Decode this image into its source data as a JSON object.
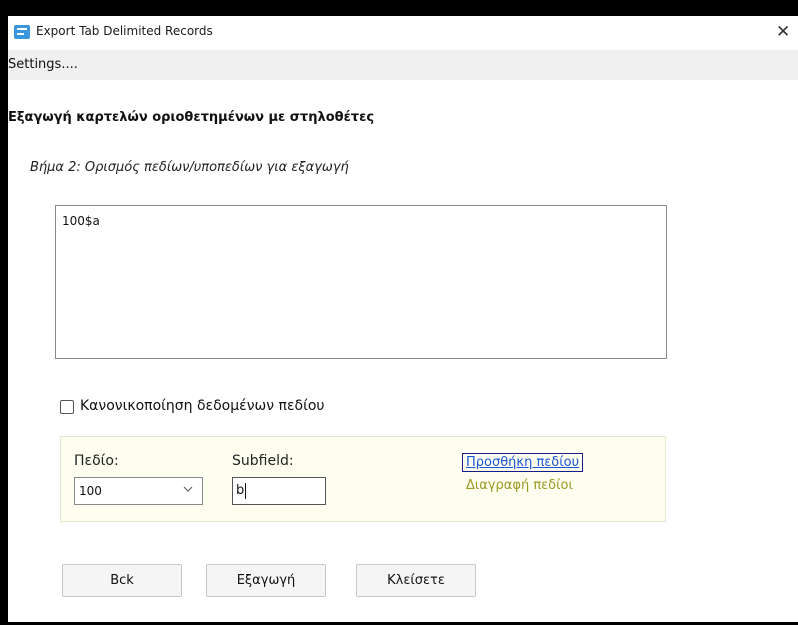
{
  "window": {
    "title": "Export Tab Delimited Records",
    "close_glyph": "✕",
    "app_icon": "table-export-icon"
  },
  "menubar": {
    "settings_label": "Settings...."
  },
  "page": {
    "heading": "Εξαγωγή καρτελών οριοθετημένων με στηλοθέτες",
    "step": "Βήμα 2: Ορισμός πεδίων/υποπεδίων για εξαγωγή"
  },
  "fields_list": {
    "items": [
      "100$a"
    ]
  },
  "normalize": {
    "label": "Κανονικοποίηση δεδομένων πεδίου",
    "checked": false
  },
  "panel": {
    "field_label": "Πεδίο:",
    "field_value": "100",
    "subfield_label": "Subfield:",
    "subfield_value": "b",
    "add_link": "Προσθήκη πεδίου",
    "delete_link": "Διαγραφή πεδίοι"
  },
  "buttons": {
    "back": "Bck",
    "export": "Εξαγωγή",
    "close": "Κλείσετε"
  }
}
